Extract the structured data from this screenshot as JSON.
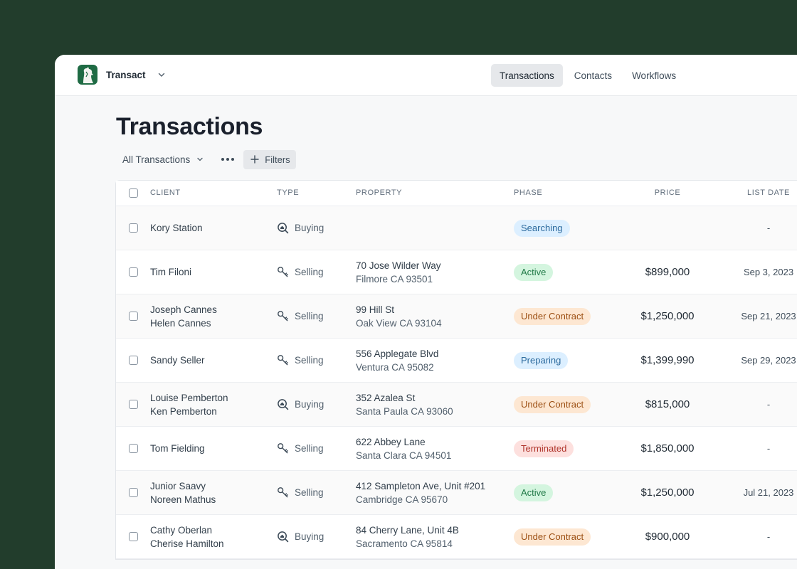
{
  "app": {
    "name": "Transact"
  },
  "nav": {
    "tabs": [
      {
        "label": "Transactions",
        "active": true
      },
      {
        "label": "Contacts",
        "active": false
      },
      {
        "label": "Workflows",
        "active": false
      }
    ]
  },
  "page": {
    "title": "Transactions",
    "view_label": "All Transactions",
    "filters_label": "Filters"
  },
  "table": {
    "columns": {
      "client": "CLIENT",
      "type": "TYPE",
      "property": "PROPERTY",
      "phase": "PHASE",
      "price": "PRICE",
      "list_date": "LIST DATE"
    },
    "rows": [
      {
        "client1": "Kory Station",
        "client2": "",
        "type": "Buying",
        "type_icon": "search-house-icon",
        "prop1": "",
        "prop2": "",
        "phase": "Searching",
        "phase_style": "blue",
        "price": "",
        "date": "-"
      },
      {
        "client1": "Tim Filoni",
        "client2": "",
        "type": "Selling",
        "type_icon": "key-icon",
        "prop1": "70 Jose Wilder Way",
        "prop2": "Filmore CA 93501",
        "phase": "Active",
        "phase_style": "green",
        "price": "$899,000",
        "date": "Sep 3, 2023"
      },
      {
        "client1": "Joseph Cannes",
        "client2": "Helen Cannes",
        "type": "Selling",
        "type_icon": "key-icon",
        "prop1": "99 Hill St",
        "prop2": "Oak View CA 93104",
        "phase": "Under Contract",
        "phase_style": "orange",
        "price": "$1,250,000",
        "date": "Sep 21, 2023"
      },
      {
        "client1": "Sandy Seller",
        "client2": "",
        "type": "Selling",
        "type_icon": "key-icon",
        "prop1": "556 Applegate Blvd",
        "prop2": "Ventura CA 95082",
        "phase": "Preparing",
        "phase_style": "blue",
        "price": "$1,399,990",
        "date": "Sep 29, 2023"
      },
      {
        "client1": "Louise Pemberton",
        "client2": "Ken Pemberton",
        "type": "Buying",
        "type_icon": "search-house-icon",
        "prop1": "352 Azalea St",
        "prop2": "Santa Paula CA 93060",
        "phase": "Under Contract",
        "phase_style": "orange",
        "price": "$815,000",
        "date": "-"
      },
      {
        "client1": "Tom Fielding",
        "client2": "",
        "type": "Selling",
        "type_icon": "key-icon",
        "prop1": "622 Abbey Lane",
        "prop2": "Santa Clara CA 94501",
        "phase": "Terminated",
        "phase_style": "red",
        "price": "$1,850,000",
        "date": "-"
      },
      {
        "client1": "Junior Saavy",
        "client2": "Noreen Mathus",
        "type": "Selling",
        "type_icon": "key-icon",
        "prop1": "412 Sampleton Ave, Unit #201",
        "prop2": "Cambridge CA 95670",
        "phase": "Active",
        "phase_style": "green",
        "price": "$1,250,000",
        "date": "Jul 21, 2023"
      },
      {
        "client1": "Cathy Oberlan",
        "client2": "Cherise Hamilton",
        "type": "Buying",
        "type_icon": "search-house-icon",
        "prop1": "84 Cherry Lane, Unit 4B",
        "prop2": "Sacramento CA 95814",
        "phase": "Under Contract",
        "phase_style": "orange",
        "price": "$900,000",
        "date": "-"
      }
    ]
  },
  "colors": {
    "background": "#223d2c",
    "brand": "#1f6b44",
    "badge_blue_bg": "#dcefff",
    "badge_blue_fg": "#2b6a9e",
    "badge_green_bg": "#d4f5df",
    "badge_green_fg": "#227a48",
    "badge_orange_bg": "#fde7d2",
    "badge_orange_fg": "#9c4f13",
    "badge_red_bg": "#fde0de",
    "badge_red_fg": "#b0352c"
  }
}
